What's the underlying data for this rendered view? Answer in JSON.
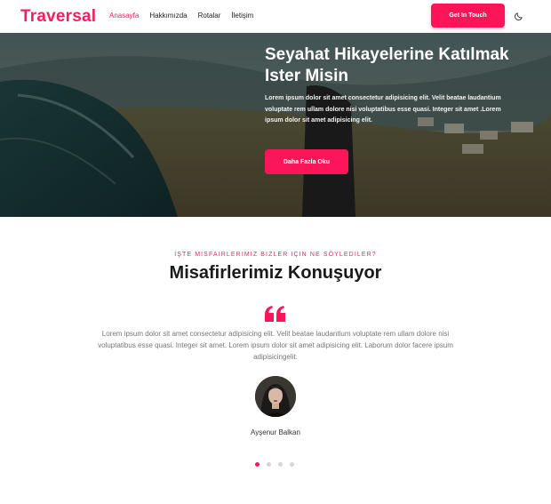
{
  "brand": {
    "name": "Traversal",
    "color": "#f0215f"
  },
  "nav": {
    "items": [
      {
        "label": "Anasayfa",
        "active": true
      },
      {
        "label": "Hakkımızda",
        "active": false
      },
      {
        "label": "Rotalar",
        "active": false
      },
      {
        "label": "İletişim",
        "active": false
      }
    ],
    "cta_label": "Get In Touch",
    "theme_icon": "moon-icon"
  },
  "hero": {
    "title": "Seyahat Hikayelerine Katılmak Ister Misin",
    "text": "Lorem ipsum dolor sit amet consectetur adipisicing elit. Velit beatae laudantium voluptate rem ullam dolore nisi voluptatibus esse quasi. Integer sit amet .Lorem ipsum dolor sit amet adipisicing elit.",
    "button_label": "Daha Fazla Oku"
  },
  "testimonials": {
    "kicker": "İŞTE MISFAIRLERIMIZ BIZLER IÇIN NE SÖYLEDILER?",
    "title": "Misafirlerimiz Konuşuyor",
    "quote_icon": "quote-icon",
    "quote": "Lorem ipsum dolor sit amet consectetur adipisicing elit. Velit beatae laudantium voluptate rem ullam dolore nisi voluptatibus esse quasi. Integer sit amet. Lorem ipsum dolor sit amet adipisicing elit. Laborum dolor facere ipsum adipisicingelit.",
    "person_name": "Ayşenur Balkan",
    "slides_total": 4,
    "active_slide": 1
  },
  "colors": {
    "accent": "#fc1659",
    "text_muted": "#777777"
  }
}
